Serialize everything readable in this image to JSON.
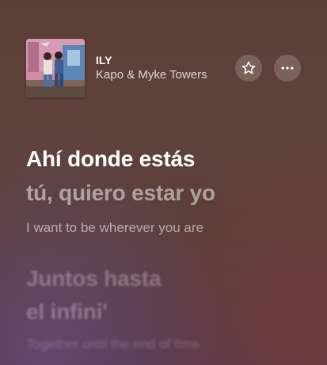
{
  "track": {
    "title": "ILY",
    "artist": "Kapo & Myke Towers"
  },
  "actions": {
    "favorite_icon": "star-icon",
    "more_icon": "ellipsis-icon"
  },
  "lyrics": {
    "active_line_1": "Ahí donde estás",
    "active_line_2": "tú, quiero estar yo",
    "active_translation": "I want to be wherever you are",
    "next_line_1": "Juntos hasta",
    "next_line_2": "el infini'",
    "next_translation": "Together until the end of time"
  }
}
